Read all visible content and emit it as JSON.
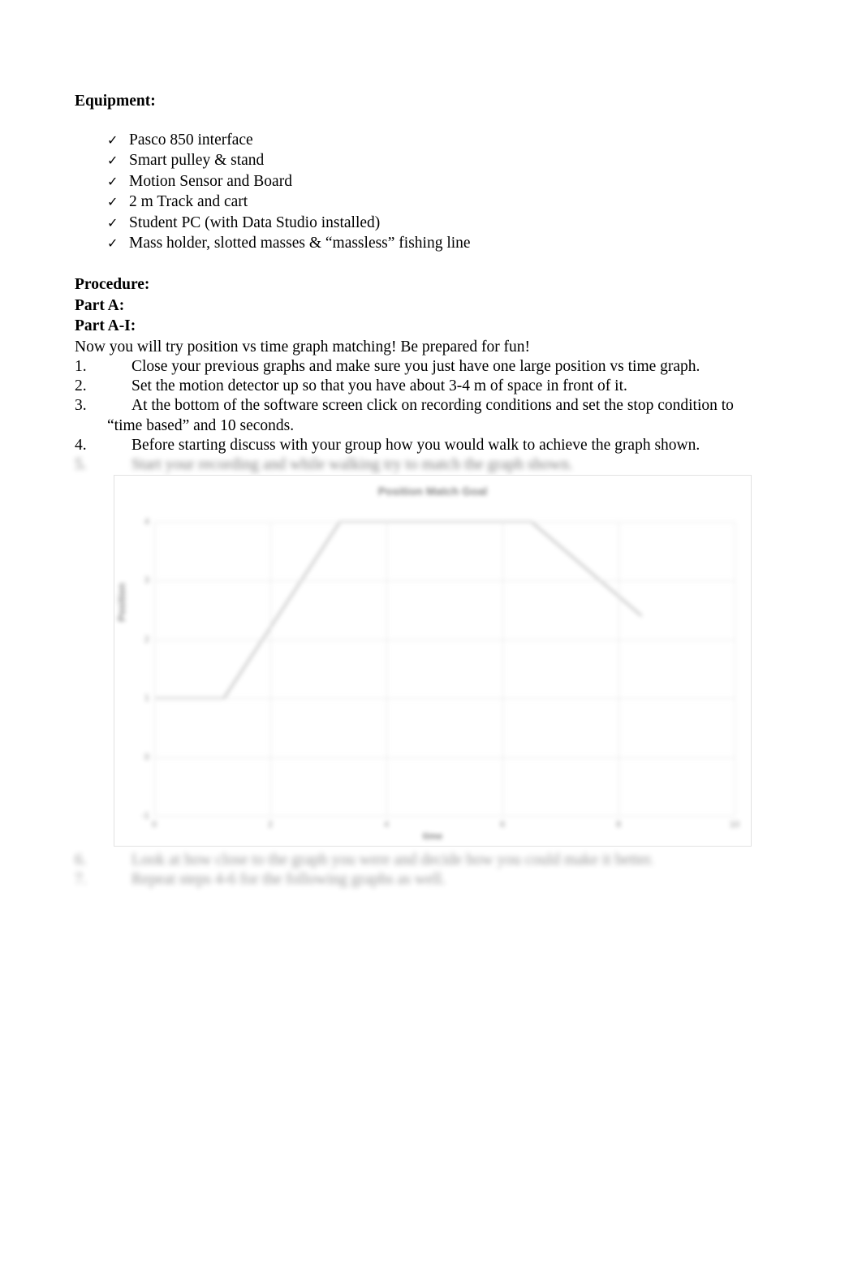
{
  "document": {
    "equipment": {
      "heading": "Equipment:",
      "items": [
        "Pasco 850 interface",
        "Smart pulley & stand",
        "Motion Sensor and Board",
        "2 m Track and cart",
        "Student PC (with Data Studio installed)",
        "Mass holder, slotted masses & “massless” fishing line"
      ],
      "bullet_glyph": "✓"
    },
    "procedure": {
      "heading": "Procedure:",
      "part_a": "Part A:",
      "part_a_i": "Part A-I:",
      "intro": "Now you will try position vs time graph matching! Be prepared for fun!",
      "steps": [
        {
          "num": "1.",
          "text": "Close your previous graphs and make sure you just have one large position vs time graph.",
          "continuation": "",
          "legible": true
        },
        {
          "num": "2.",
          "text": "Set the motion detector up so that you have about 3-4 m of space in front of it.",
          "continuation": "",
          "legible": true
        },
        {
          "num": "3.",
          "text": "At the bottom of the software screen click on recording conditions and set the stop condition to",
          "continuation": "“time based” and 10 seconds.",
          "legible": true
        },
        {
          "num": "4.",
          "text": "Before starting discuss with your group how you would walk to achieve the graph shown.",
          "continuation": "",
          "legible": true
        },
        {
          "num": "5.",
          "text": "Start your recording and while walking try to match the graph shown.",
          "continuation": "",
          "legible": false
        }
      ],
      "steps_after_chart": [
        {
          "num": "6.",
          "text": "Look at how close to the graph you were and decide how you could make it better.",
          "legible": false
        },
        {
          "num": "7.",
          "text": "Repeat steps 4-6 for the following graphs as well.",
          "legible": false
        }
      ]
    }
  },
  "chart_data": {
    "type": "line",
    "title": "Position Match Goal",
    "xlabel": "time",
    "ylabel": "Position",
    "grid": true,
    "legend": "none",
    "xlim": [
      0,
      10
    ],
    "ylim": [
      -1,
      4
    ],
    "xticks": [
      0,
      2,
      4,
      6,
      8,
      10
    ],
    "yticks": [
      4,
      3,
      2,
      1,
      0,
      -1
    ],
    "xtick_labels": [
      "0",
      "2",
      "4",
      "6",
      "8",
      "10"
    ],
    "ytick_labels": [
      "4",
      "3",
      "2",
      "1",
      "0",
      "-1"
    ],
    "series": [
      {
        "name": "Position",
        "x": [
          0.0,
          1.2,
          3.2,
          6.5,
          8.4
        ],
        "y": [
          1.0,
          1.0,
          4.0,
          4.0,
          2.4
        ]
      }
    ]
  }
}
